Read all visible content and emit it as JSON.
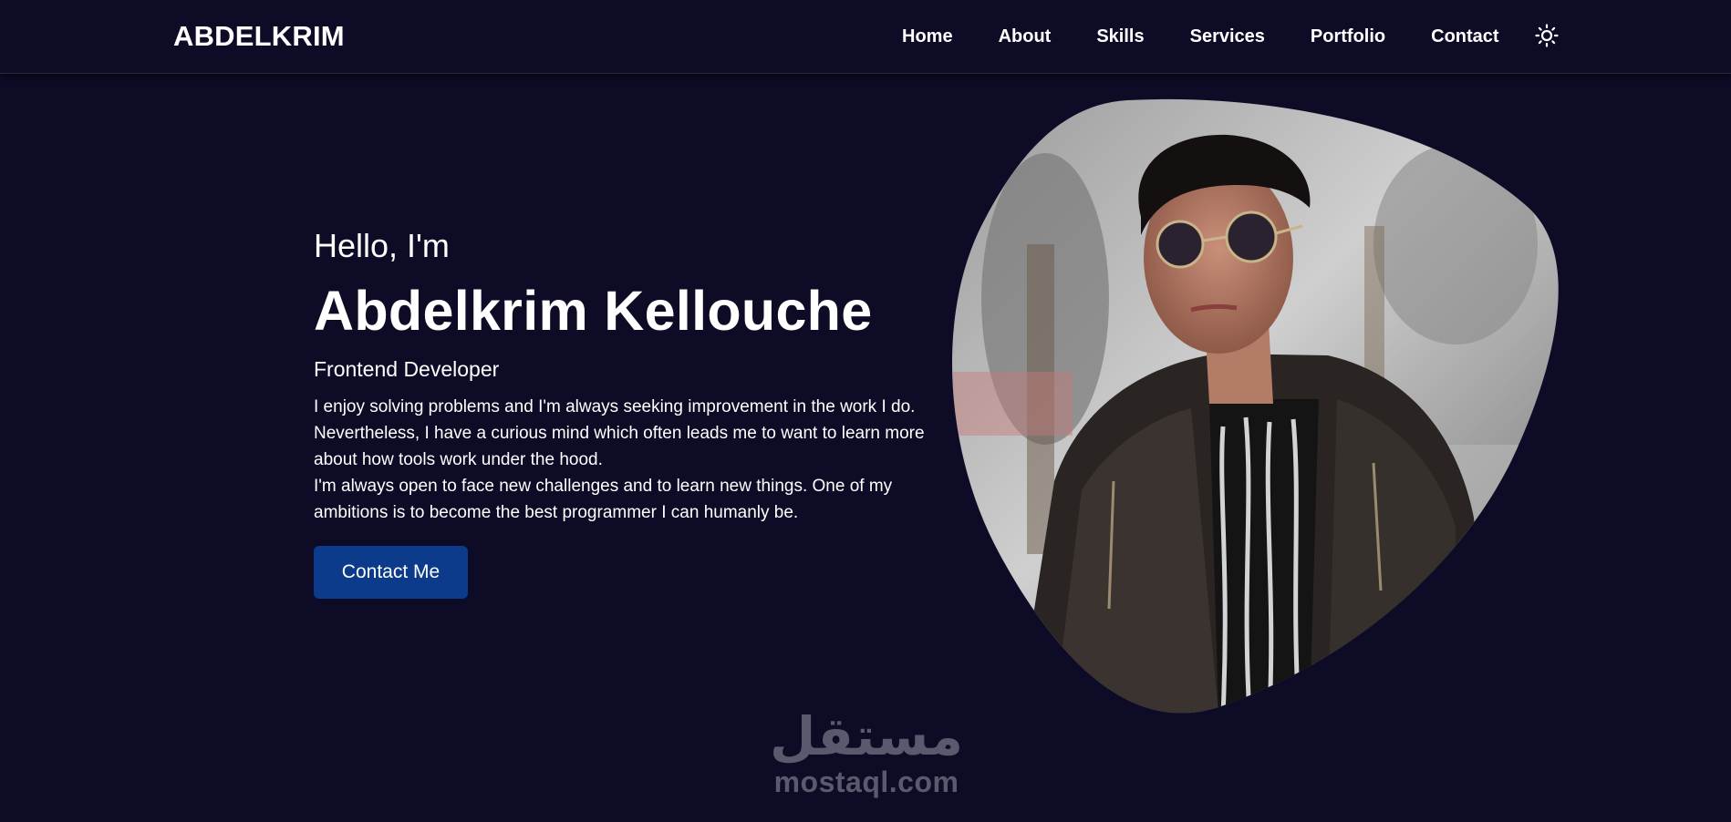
{
  "navbar": {
    "logo": "ABDELKRIM",
    "links": [
      "Home",
      "About",
      "Skills",
      "Services",
      "Portfolio",
      "Contact"
    ],
    "theme_icon": "sun-icon"
  },
  "hero": {
    "greeting": "Hello, I'm",
    "name": "Abdelkrim Kellouche",
    "role": "Frontend Developer",
    "bio_1": "I enjoy solving problems and I'm always seeking improvement in the work I do. Nevertheless, I have a curious mind which often leads me to want to learn more about how tools work under the hood.",
    "bio_2": "I'm always open to face new challenges and to learn new things. One of my ambitions is to become the best programmer I can humanly be.",
    "cta_label": "Contact Me"
  },
  "watermark": {
    "arabic": "مستقل",
    "latin": "mostaql.com"
  },
  "colors": {
    "background": "#0d0b26",
    "button": "#0b3b8a",
    "text": "#ffffff"
  }
}
